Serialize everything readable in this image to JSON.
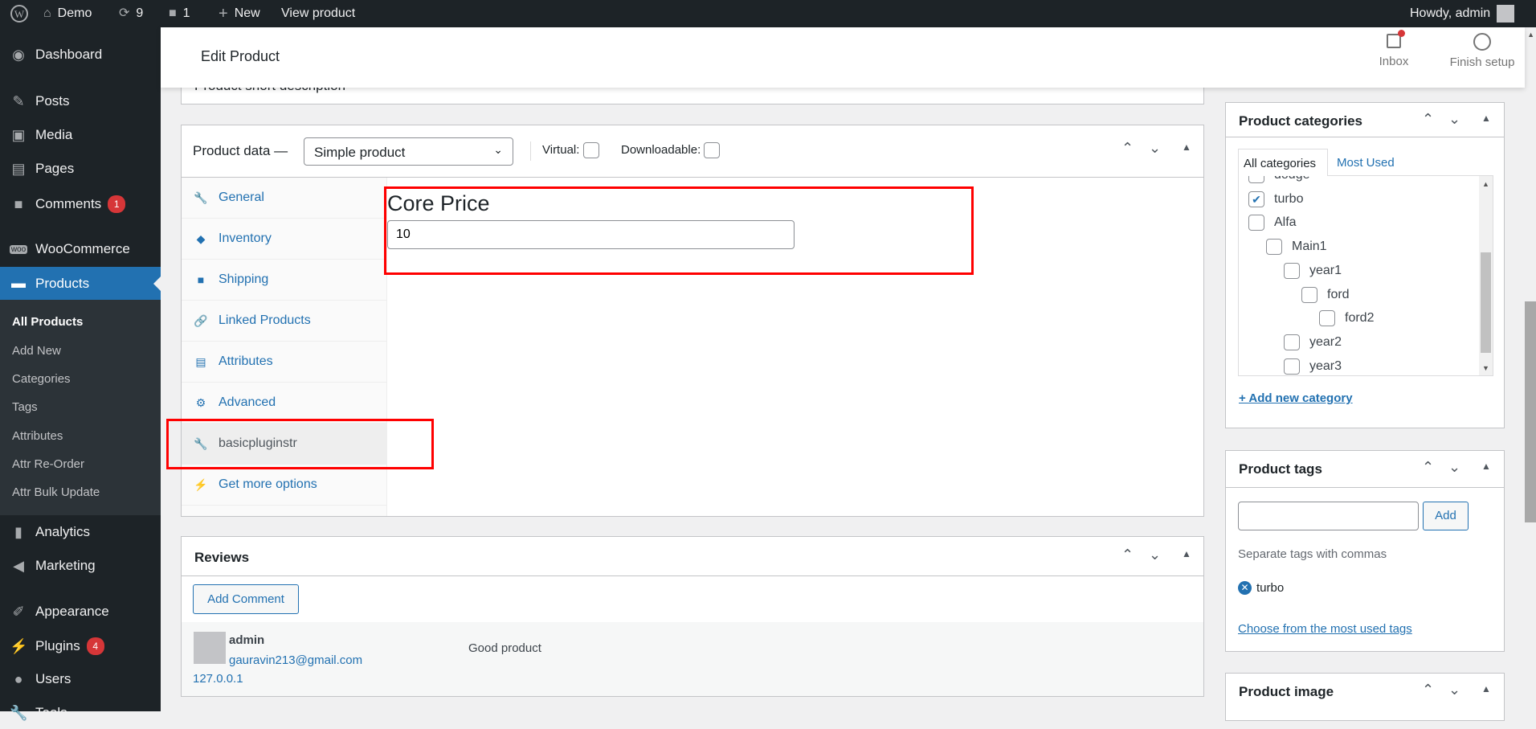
{
  "adminbar": {
    "site": "Demo",
    "updates": "9",
    "comments": "1",
    "new": "New",
    "view": "View product",
    "howdy": "Howdy, admin"
  },
  "sidebar": {
    "items": [
      {
        "label": "Dashboard",
        "icon": "dashboard-icon"
      },
      {
        "label": "Posts",
        "icon": "pin-icon"
      },
      {
        "label": "Media",
        "icon": "media-icon"
      },
      {
        "label": "Pages",
        "icon": "pages-icon"
      },
      {
        "label": "Comments",
        "icon": "comment-icon",
        "badge": "1"
      },
      {
        "label": "WooCommerce",
        "icon": "woo-icon"
      },
      {
        "label": "Products",
        "icon": "products-icon"
      },
      {
        "label": "Analytics",
        "icon": "chart-icon"
      },
      {
        "label": "Marketing",
        "icon": "megaphone-icon"
      },
      {
        "label": "Appearance",
        "icon": "brush-icon"
      },
      {
        "label": "Plugins",
        "icon": "plugin-icon",
        "badge": "4"
      },
      {
        "label": "Users",
        "icon": "users-icon"
      },
      {
        "label": "Tools",
        "icon": "tools-icon"
      }
    ],
    "submenu": [
      "All Products",
      "Add New",
      "Categories",
      "Tags",
      "Attributes",
      "Attr Re-Order",
      "Attr Bulk Update"
    ]
  },
  "header": {
    "title": "Edit Product",
    "inbox": "Inbox",
    "finish": "Finish setup"
  },
  "short_desc": {
    "title": "Product short description"
  },
  "product_data": {
    "title": "Product data —",
    "type": "Simple product",
    "virtual": "Virtual:",
    "downloadable": "Downloadable:",
    "tabs": [
      "General",
      "Inventory",
      "Shipping",
      "Linked Products",
      "Attributes",
      "Advanced",
      "basicpluginstr",
      "Get more options"
    ],
    "field_label": "Core Price",
    "field_value": "10"
  },
  "reviews": {
    "title": "Reviews",
    "add": "Add Comment",
    "author": "admin",
    "email": "gauravin213@gmail.com",
    "ip": "127.0.0.1",
    "text": "Good product"
  },
  "categories": {
    "title": "Product categories",
    "tab_all": "All categories",
    "tab_used": "Most Used",
    "add": "+ Add new category",
    "items": [
      {
        "label": "dodge",
        "checked": false,
        "level": 0
      },
      {
        "label": "turbo",
        "checked": true,
        "level": 0
      },
      {
        "label": "Alfa",
        "checked": false,
        "level": 0
      },
      {
        "label": "Main1",
        "checked": false,
        "level": 1
      },
      {
        "label": "year1",
        "checked": false,
        "level": 2
      },
      {
        "label": "ford",
        "checked": false,
        "level": 3
      },
      {
        "label": "ford2",
        "checked": false,
        "level": 4
      },
      {
        "label": "year2",
        "checked": false,
        "level": 2
      },
      {
        "label": "year3",
        "checked": false,
        "level": 2
      }
    ]
  },
  "tags": {
    "title": "Product tags",
    "input": "",
    "add": "Add",
    "hint": "Separate tags with commas",
    "tag": "turbo",
    "choose": "Choose from the most used tags"
  },
  "image": {
    "title": "Product image"
  },
  "colors": {
    "accent": "#2271b1",
    "highlight": "#ff0000",
    "menu_bg": "#1d2327",
    "active": "#2271b1"
  }
}
